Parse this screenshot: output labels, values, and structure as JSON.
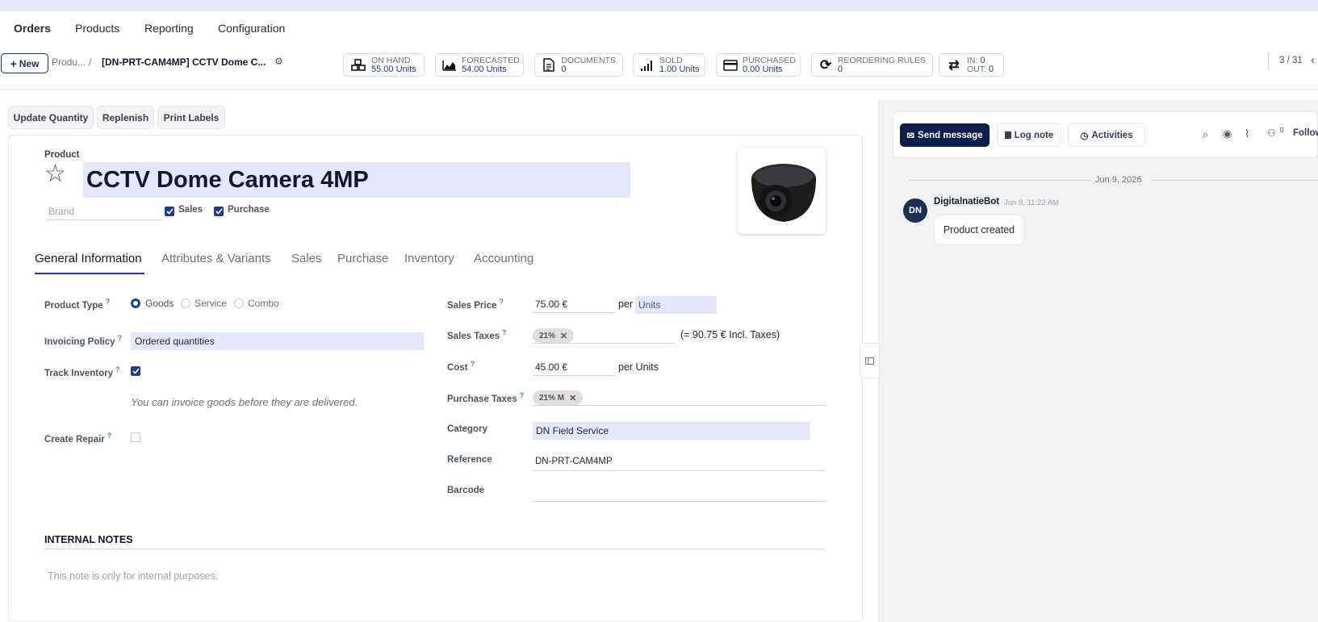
{
  "menu": {
    "orders": "Orders",
    "products": "Products",
    "reporting": "Reporting",
    "configuration": "Configuration"
  },
  "control": {
    "new_label": "New",
    "breadcrumb_parent": "Produ...",
    "breadcrumb_sep": "/",
    "breadcrumb_current": "[DN-PRT-CAM4MP] CCTV Dome C...",
    "pager": "3 / 31"
  },
  "stats": {
    "on_hand": {
      "label": "ON HAND",
      "value": "55.00 Units"
    },
    "forecasted": {
      "label": "FORECASTED",
      "value": "54.00 Units"
    },
    "documents": {
      "label": "DOCUMENTS",
      "value": "0"
    },
    "sold": {
      "label": "SOLD",
      "value": "1.00 Units"
    },
    "purchased": {
      "label": "PURCHASED",
      "value": "0.00 Units"
    },
    "reordering": {
      "label": "REORDERING RULES",
      "value": "0"
    },
    "in_label": "IN:",
    "in_value": "0",
    "out_label": "OUT:",
    "out_value": "0"
  },
  "actions": {
    "update_quantity": "Update Quantity",
    "replenish": "Replenish",
    "print_labels": "Print Labels"
  },
  "product": {
    "label": "Product",
    "name": "CCTV Dome Camera 4MP",
    "brand_placeholder": "Brand",
    "sales_check": "Sales",
    "purchase_check": "Purchase"
  },
  "tabs": [
    "General Information",
    "Attributes & Variants",
    "Sales",
    "Purchase",
    "Inventory",
    "Accounting"
  ],
  "left_form": {
    "product_type_label": "Product Type",
    "type_goods": "Goods",
    "type_service": "Service",
    "type_combo": "Combo",
    "invoicing_label": "Invoicing Policy",
    "invoicing_value": "Ordered quantities",
    "track_label": "Track Inventory",
    "hint": "You can invoice goods before they are delivered.",
    "repair_label": "Create Repair"
  },
  "right_form": {
    "sales_price_label": "Sales Price",
    "sales_price_value": "75.00 €",
    "per": "per",
    "uom": "Units",
    "sales_taxes_label": "Sales Taxes",
    "sales_tax_tag": "21%",
    "incl_taxes": "(= 90.75 € Incl. Taxes)",
    "cost_label": "Cost",
    "cost_value": "45.00 €",
    "per_units": "per Units",
    "purchase_taxes_label": "Purchase Taxes",
    "purchase_tax_tag": "21% M",
    "category_label": "Category",
    "category_value": "DN Field Service",
    "reference_label": "Reference",
    "reference_value": "DN-PRT-CAM4MP",
    "barcode_label": "Barcode"
  },
  "notes": {
    "title": "INTERNAL NOTES",
    "placeholder": "This note is only for internal purposes."
  },
  "chatter": {
    "send_message": "Send message",
    "log_note": "Log note",
    "activities": "Activities",
    "followers_count": "0",
    "follow": "Follow",
    "date_sep": "Jun 9, 2026",
    "msg_author": "DigitalnatieBot",
    "msg_time": "Jun 9, 11:22 AM",
    "msg_body": "Product created",
    "avatar_initials": "DN"
  },
  "colors": {
    "accent": "#1f3c88",
    "dark_btn": "#0b1d4a",
    "highlight": "#e5e7fd"
  }
}
